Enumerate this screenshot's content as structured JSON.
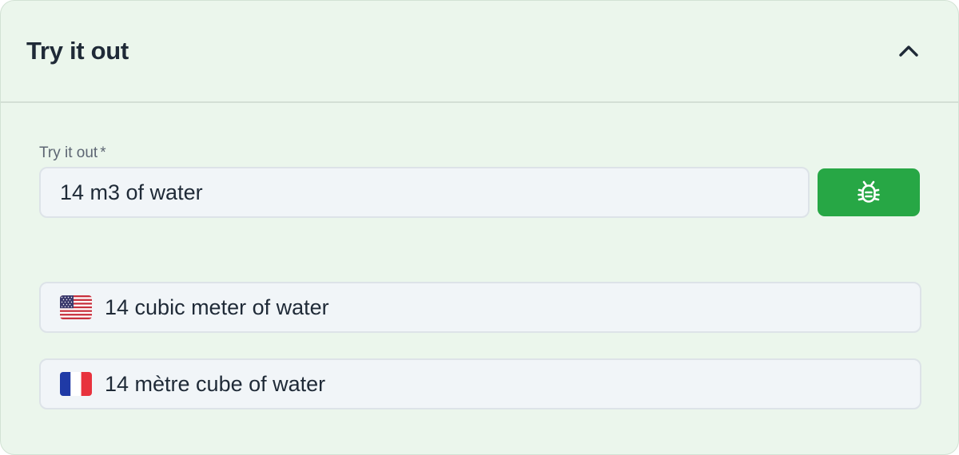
{
  "panel": {
    "title": "Try it out",
    "collapse_icon": "chevron-up-icon"
  },
  "form": {
    "label": "Try it out",
    "required_marker": "*",
    "input_value": "14 m3 of water",
    "debug_button_icon": "bug-icon",
    "debug_button_color": "#27a745"
  },
  "results": [
    {
      "flag_icon": "us-flag-icon",
      "text": "14 cubic meter of water"
    },
    {
      "flag_icon": "france-flag-icon",
      "text": "14 mètre cube of water"
    }
  ],
  "colors": {
    "panel_background": "#ebf6ec",
    "input_background": "#f1f5f8",
    "text": "#1f2a37"
  }
}
